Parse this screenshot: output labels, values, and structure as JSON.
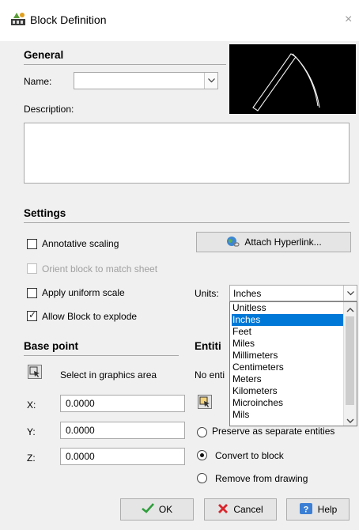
{
  "window": {
    "title": "Block Definition",
    "close_glyph": "×"
  },
  "general": {
    "section_title": "General",
    "name_label": "Name:",
    "name_value": "",
    "description_label": "Description:",
    "description_value": ""
  },
  "settings": {
    "section_title": "Settings",
    "annotative_label": "Annotative scaling",
    "annotative_checked": false,
    "orient_label": "Orient block to match sheet",
    "orient_enabled": false,
    "uniform_label": "Apply uniform scale",
    "uniform_checked": false,
    "explode_label": "Allow Block to explode",
    "explode_checked": true,
    "hyperlink_label": "Attach Hyperlink...",
    "units_label": "Units:",
    "units_value": "Inches"
  },
  "units_dropdown": {
    "options": [
      "Unitless",
      "Inches",
      "Feet",
      "Miles",
      "Millimeters",
      "Centimeters",
      "Meters",
      "Kilometers",
      "Microinches",
      "Mils"
    ],
    "selected_index": 1
  },
  "base_point": {
    "section_title": "Base point",
    "select_label": "Select in graphics area",
    "x_label": "X:",
    "x_value": "0.0000",
    "y_label": "Y:",
    "y_value": "0.0000",
    "z_label": "Z:",
    "z_value": "0.0000"
  },
  "entities": {
    "section_title": "Entiti",
    "no_entities_text": "No enti",
    "preserve_label": "Preserve as separate entities",
    "convert_label": "Convert to block",
    "remove_label": "Remove from drawing",
    "selected_option": "convert"
  },
  "footer": {
    "ok_label": "OK",
    "cancel_label": "Cancel",
    "help_label": "Help"
  },
  "colors": {
    "selection": "#0078d7",
    "ok_check": "#2e9e3b",
    "cancel_x": "#d8262c",
    "help_icon": "#3b7fd4"
  }
}
